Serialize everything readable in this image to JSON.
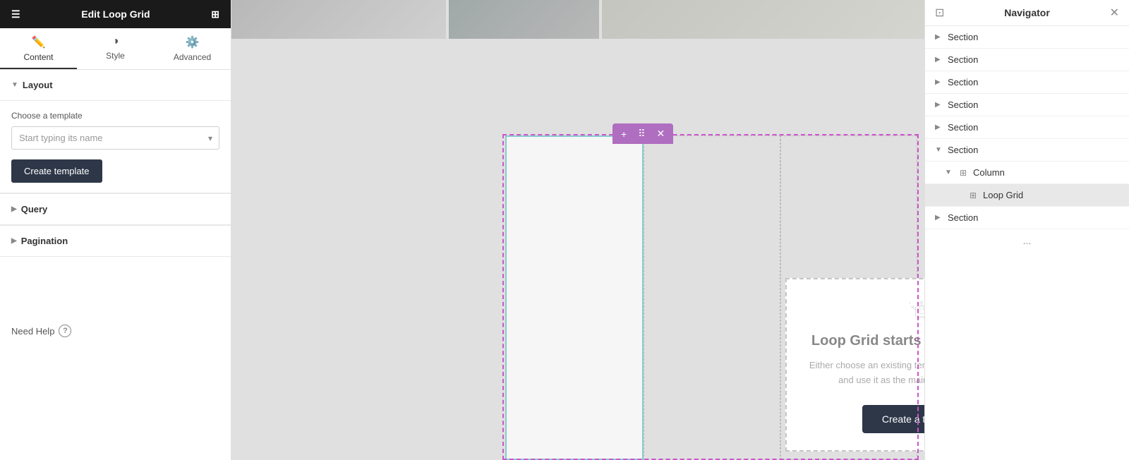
{
  "header": {
    "title": "Edit Loop Grid",
    "hamburger_icon": "☰",
    "grid_icon": "⊞"
  },
  "tabs": [
    {
      "id": "content",
      "label": "Content",
      "icon": "✏️",
      "active": true
    },
    {
      "id": "style",
      "label": "Style",
      "icon": "◑"
    },
    {
      "id": "advanced",
      "label": "Advanced",
      "icon": "⚙️"
    }
  ],
  "layout_section": {
    "label": "Layout",
    "choose_template_label": "Choose a template",
    "template_placeholder": "Start typing its name",
    "create_template_label": "Create template"
  },
  "query_section": {
    "label": "Query"
  },
  "pagination_section": {
    "label": "Pagination"
  },
  "need_help": {
    "label": "Need Help",
    "icon": "?"
  },
  "loop_grid_card": {
    "title": "Loop Grid starts with a template.",
    "description": "Either choose an existing template or create a new one and use it as the main item for your loop.",
    "create_btn": "Create a template"
  },
  "toolbar": {
    "plus": "+",
    "move": "⠿",
    "close": "✕"
  },
  "navigator": {
    "title": "Navigator",
    "close": "✕",
    "items": [
      {
        "id": "section1",
        "label": "Section",
        "level": 0,
        "expanded": false,
        "arrow": "▶"
      },
      {
        "id": "section2",
        "label": "Section",
        "level": 0,
        "expanded": false,
        "arrow": "▶"
      },
      {
        "id": "section3",
        "label": "Section",
        "level": 0,
        "expanded": false,
        "arrow": "▶"
      },
      {
        "id": "section4",
        "label": "Section",
        "level": 0,
        "expanded": false,
        "arrow": "▶"
      },
      {
        "id": "section5",
        "label": "Section",
        "level": 0,
        "expanded": false,
        "arrow": "▶"
      },
      {
        "id": "section6",
        "label": "Section",
        "level": 0,
        "expanded": true,
        "arrow": "▼"
      },
      {
        "id": "column1",
        "label": "Column",
        "level": 1,
        "expanded": true,
        "arrow": "▼",
        "icon": "⊞"
      },
      {
        "id": "loopgrid1",
        "label": "Loop Grid",
        "level": 2,
        "expanded": false,
        "arrow": "",
        "icon": "⊞",
        "active": true
      },
      {
        "id": "section7",
        "label": "Section",
        "level": 0,
        "expanded": false,
        "arrow": "▶"
      }
    ],
    "dots": "..."
  }
}
